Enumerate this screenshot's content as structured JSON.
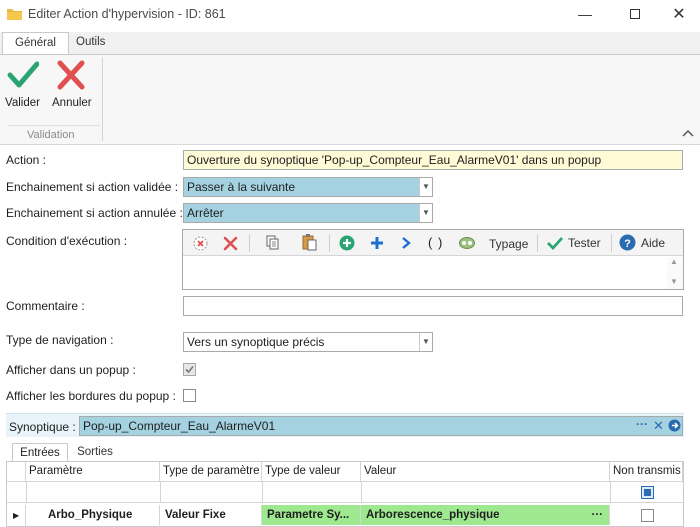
{
  "window": {
    "title": "Editer Action d'hypervision - ID: 861"
  },
  "ribbon": {
    "tabs": [
      "Général",
      "Outils"
    ],
    "validate_label": "Valider",
    "cancel_label": "Annuler",
    "group_label": "Validation"
  },
  "form": {
    "action_label": "Action :",
    "action_value": "Ouverture du synoptique 'Pop-up_Compteur_Eau_AlarmeV01' dans un popup",
    "on_valid_label": "Enchainement si action validée :",
    "on_valid_value": "Passer à la suivante",
    "on_cancel_label": "Enchainement si action annulée :",
    "on_cancel_value": "Arrêter",
    "condition_label": "Condition d'exécution :",
    "comment_label": "Commentaire :",
    "comment_value": "",
    "nav_type_label": "Type de navigation :",
    "nav_type_value": "Vers un synoptique précis",
    "popup_label": "Afficher dans un popup :",
    "popup_checked": true,
    "borders_label": "Afficher les bordures du popup :",
    "borders_checked": false
  },
  "condition_toolbar": {
    "typage_label": "Typage",
    "tester_label": "Tester",
    "aide_label": "Aide",
    "parens": "( )"
  },
  "synoptique": {
    "label": "Synoptique :",
    "value": "Pop-up_Compteur_Eau_AlarmeV01",
    "more": "···"
  },
  "subtabs": [
    "Entrées",
    "Sorties"
  ],
  "grid": {
    "headers": [
      "Paramètre",
      "Type de paramètre",
      "Type de valeur",
      "Valeur",
      "Non transmis"
    ],
    "rows": [
      {
        "param": "Arbo_Physique",
        "param_type": "Valeur Fixe",
        "value_type": "Parametre Sy...",
        "value": "Arborescence_physique",
        "more": "···",
        "non_transmis": false
      }
    ]
  },
  "colors": {
    "green_cell": "#9ee88f",
    "yellow_field": "#fffbd6",
    "blue_field": "#a5d2e0",
    "accent_blue": "#1f6fd1"
  }
}
